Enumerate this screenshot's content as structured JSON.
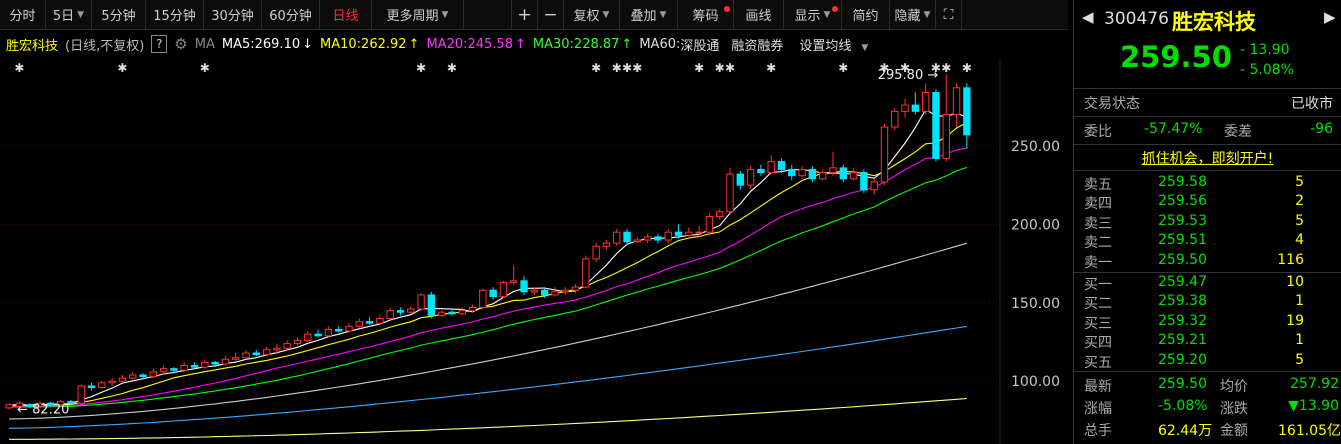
{
  "toolbar": {
    "tabs": [
      {
        "label": "分时",
        "name": "tab-intraday",
        "active": false,
        "caret": false
      },
      {
        "label": "5日",
        "name": "tab-5day",
        "active": false,
        "caret": true
      },
      {
        "label": "5分钟",
        "name": "tab-5min",
        "active": false,
        "caret": false
      },
      {
        "label": "15分钟",
        "name": "tab-15min",
        "active": false,
        "caret": false
      },
      {
        "label": "30分钟",
        "name": "tab-30min",
        "active": false,
        "caret": false
      },
      {
        "label": "60分钟",
        "name": "tab-60min",
        "active": false,
        "caret": false
      },
      {
        "label": "日线",
        "name": "tab-daily",
        "active": true,
        "caret": false
      },
      {
        "label": "更多周期",
        "name": "tab-more-periods",
        "active": false,
        "caret": true
      }
    ],
    "zoom_in": "+",
    "zoom_out": "−",
    "tools": [
      {
        "label": "复权",
        "name": "adjust-button",
        "caret": true,
        "dot": false
      },
      {
        "label": "叠加",
        "name": "overlay-button",
        "caret": true,
        "dot": false
      },
      {
        "label": "筹码",
        "name": "chips-button",
        "caret": false,
        "dot": true
      },
      {
        "label": "画线",
        "name": "draw-line-button",
        "caret": false,
        "dot": false
      },
      {
        "label": "显示",
        "name": "display-button",
        "caret": true,
        "dot": true
      },
      {
        "label": "简约",
        "name": "simple-button",
        "caret": false,
        "dot": false
      },
      {
        "label": "隐藏",
        "name": "hide-button",
        "caret": true,
        "dot": false
      }
    ]
  },
  "info": {
    "stock_name": "胜宏科技",
    "mode": "(日线,不复权)",
    "help": "?",
    "ma_label": "MA",
    "ma5": "MA5:269.10",
    "ma5_arrow": "↓",
    "ma10": "MA10:262.92",
    "ma10_arrow": "↑",
    "ma20": "MA20:245.58",
    "ma20_arrow": "↑",
    "ma30": "MA30:228.87",
    "ma30_arrow": "↑",
    "ma60": "MA60:",
    "deep_link": "深股通",
    "margin": "融资融券",
    "set_ma": "设置均线"
  },
  "chart_data": {
    "type": "candlestick",
    "y_ticks": [
      "250.00",
      "200.00",
      "150.00",
      "100.00"
    ],
    "y_tick_values": [
      250,
      200,
      150,
      100
    ],
    "ylim": [
      60,
      306
    ],
    "high_label": "295.80",
    "low_label": "82.20",
    "candles": [
      [
        83,
        85,
        82,
        86
      ],
      [
        84,
        86,
        83,
        87
      ],
      [
        85,
        84,
        83,
        86
      ],
      [
        84,
        86,
        83,
        87
      ],
      [
        86,
        85,
        84,
        87
      ],
      [
        85,
        87,
        84,
        88
      ],
      [
        87,
        86,
        85,
        88
      ],
      [
        86,
        97,
        85,
        98
      ],
      [
        97,
        96,
        94,
        99
      ],
      [
        96,
        99,
        95,
        100
      ],
      [
        99,
        100,
        97,
        102
      ],
      [
        100,
        102,
        99,
        104
      ],
      [
        102,
        104,
        101,
        106
      ],
      [
        104,
        103,
        101,
        105
      ],
      [
        103,
        106,
        102,
        108
      ],
      [
        106,
        108,
        104,
        110
      ],
      [
        108,
        107,
        105,
        109
      ],
      [
        107,
        110,
        106,
        112
      ],
      [
        110,
        109,
        108,
        112
      ],
      [
        109,
        112,
        108,
        114
      ],
      [
        112,
        111,
        109,
        113
      ],
      [
        111,
        114,
        110,
        116
      ],
      [
        114,
        115,
        113,
        118
      ],
      [
        115,
        118,
        114,
        120
      ],
      [
        118,
        117,
        116,
        120
      ],
      [
        117,
        120,
        116,
        122
      ],
      [
        120,
        121,
        118,
        124
      ],
      [
        121,
        124,
        120,
        126
      ],
      [
        124,
        126,
        123,
        128
      ],
      [
        126,
        130,
        125,
        132
      ],
      [
        130,
        129,
        128,
        133
      ],
      [
        129,
        133,
        128,
        135
      ],
      [
        133,
        132,
        131,
        135
      ],
      [
        132,
        135,
        131,
        137
      ],
      [
        135,
        138,
        134,
        140
      ],
      [
        138,
        137,
        136,
        141
      ],
      [
        137,
        140,
        136,
        142
      ],
      [
        140,
        145,
        139,
        147
      ],
      [
        145,
        144,
        142,
        147
      ],
      [
        144,
        146,
        143,
        148
      ],
      [
        146,
        155,
        145,
        156
      ],
      [
        155,
        142,
        140,
        157
      ],
      [
        142,
        144,
        141,
        145
      ],
      [
        144,
        143,
        142,
        146
      ],
      [
        143,
        145,
        142,
        147
      ],
      [
        145,
        147,
        144,
        149
      ],
      [
        147,
        158,
        146,
        159
      ],
      [
        158,
        154,
        152,
        160
      ],
      [
        154,
        163,
        153,
        164
      ],
      [
        163,
        164,
        161,
        174
      ],
      [
        164,
        157,
        155,
        167
      ],
      [
        157,
        158,
        155,
        160
      ],
      [
        158,
        155,
        153,
        159
      ],
      [
        155,
        157,
        154,
        160
      ],
      [
        157,
        158,
        155,
        160
      ],
      [
        158,
        160,
        156,
        162
      ],
      [
        160,
        178,
        159,
        180
      ],
      [
        178,
        186,
        176,
        188
      ],
      [
        186,
        188,
        184,
        190
      ],
      [
        188,
        195,
        186,
        197
      ],
      [
        195,
        189,
        187,
        197
      ],
      [
        189,
        190,
        188,
        192
      ],
      [
        190,
        192,
        188,
        194
      ],
      [
        192,
        190,
        188,
        194
      ],
      [
        190,
        195,
        188,
        197
      ],
      [
        195,
        193,
        191,
        200
      ],
      [
        193,
        195,
        192,
        198
      ],
      [
        195,
        195,
        192,
        199
      ],
      [
        195,
        205,
        193,
        207
      ],
      [
        205,
        208,
        203,
        210
      ],
      [
        208,
        232,
        206,
        236
      ],
      [
        232,
        225,
        222,
        234
      ],
      [
        225,
        235,
        223,
        237
      ],
      [
        235,
        233,
        231,
        238
      ],
      [
        233,
        240,
        232,
        244
      ],
      [
        240,
        235,
        233,
        242
      ],
      [
        235,
        231,
        228,
        238
      ],
      [
        231,
        235,
        229,
        237
      ],
      [
        235,
        229,
        227,
        237
      ],
      [
        229,
        233,
        228,
        235
      ],
      [
        233,
        236,
        231,
        246
      ],
      [
        236,
        229,
        227,
        238
      ],
      [
        229,
        233,
        228,
        236
      ],
      [
        233,
        222,
        220,
        235
      ],
      [
        222,
        227,
        219,
        229
      ],
      [
        227,
        262,
        225,
        264
      ],
      [
        262,
        272,
        260,
        274
      ],
      [
        272,
        276,
        268,
        280
      ],
      [
        276,
        272,
        270,
        284
      ],
      [
        272,
        284,
        270,
        290
      ],
      [
        284,
        242,
        240,
        286
      ],
      [
        242,
        270,
        240,
        295.8
      ],
      [
        270,
        287,
        262,
        290
      ],
      [
        287,
        257,
        248,
        290
      ]
    ]
  },
  "quote": {
    "code": "300476",
    "name": "胜宏科技",
    "price": "259.50",
    "change": "- 13.90",
    "change_pct": "- 5.08%",
    "status_label": "交易状态",
    "status_value": "已收市",
    "wb_label": "委比",
    "wb_value": "-57.47%",
    "wc_label": "委差",
    "wc_value": "-96",
    "promo": "抓住机会，即刻开户!",
    "asks": [
      {
        "label": "卖五",
        "price": "259.58",
        "vol": "5"
      },
      {
        "label": "卖四",
        "price": "259.56",
        "vol": "2"
      },
      {
        "label": "卖三",
        "price": "259.53",
        "vol": "5"
      },
      {
        "label": "卖二",
        "price": "259.51",
        "vol": "4"
      },
      {
        "label": "卖一",
        "price": "259.50",
        "vol": "116"
      }
    ],
    "bids": [
      {
        "label": "买一",
        "price": "259.47",
        "vol": "10"
      },
      {
        "label": "买二",
        "price": "259.38",
        "vol": "1"
      },
      {
        "label": "买三",
        "price": "259.32",
        "vol": "19"
      },
      {
        "label": "买四",
        "price": "259.21",
        "vol": "1"
      },
      {
        "label": "买五",
        "price": "259.20",
        "vol": "5"
      }
    ],
    "latest_label": "最新",
    "latest_value": "259.50",
    "avg_label": "均价",
    "avg_value": "257.92",
    "amp_label": "涨幅",
    "amp_value": "-5.08%",
    "chg_label": "涨跌",
    "chg_value": "▼13.90",
    "vol_label": "总手",
    "vol_value": "62.44万",
    "amt_label": "金额",
    "amt_value": "161.05亿"
  },
  "colors": {
    "up": "#ff3030",
    "down": "#00e5ff",
    "ma5": "#ffffff",
    "ma10": "#ffff00",
    "ma20": "#ff00ff",
    "ma30": "#00ff00",
    "ma60": "#cccccc",
    "ma_extra1": "#3fa9ff",
    "ma_extra2": "#ffff80",
    "quote_price": "#00e000"
  }
}
